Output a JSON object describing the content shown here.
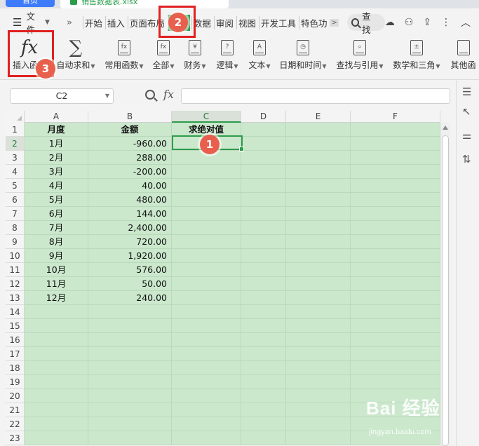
{
  "tabs": {
    "home": "首页",
    "file": "销售数据表.xlsx"
  },
  "menu": {
    "file_label": "文件",
    "more_symbol": "»",
    "items": [
      "开始",
      "插入",
      "页面布局",
      "公式",
      "数据",
      "审阅",
      "视图",
      "开发工具",
      "特色功"
    ],
    "active_index": 3,
    "scroll_symbol": ">",
    "search_label": "查找"
  },
  "ribbon": {
    "buttons": [
      {
        "label": "插入函数",
        "dropdown": false
      },
      {
        "label": "自动求和",
        "dropdown": true
      },
      {
        "label": "常用函数",
        "dropdown": true
      },
      {
        "label": "全部",
        "dropdown": true
      },
      {
        "label": "财务",
        "dropdown": true
      },
      {
        "label": "逻辑",
        "dropdown": true
      },
      {
        "label": "文本",
        "dropdown": true
      },
      {
        "label": "日期和时间",
        "dropdown": true
      },
      {
        "label": "查找与引用",
        "dropdown": true
      },
      {
        "label": "数学和三角",
        "dropdown": true
      },
      {
        "label": "其他函",
        "dropdown": false
      }
    ],
    "icon_fx": "fx",
    "icon_sigma": "∑",
    "icon_finance": "¥",
    "icon_logic": "?",
    "icon_text": "A"
  },
  "formula_bar": {
    "name_box": "C2",
    "fx_label": "fx",
    "value": ""
  },
  "sheet": {
    "columns": [
      "A",
      "B",
      "C",
      "D",
      "E",
      "F"
    ],
    "selected_column": "C",
    "selected_row": 2,
    "row_numbers": [
      "1",
      "2",
      "3",
      "4",
      "5",
      "6",
      "7",
      "8",
      "9",
      "10",
      "11",
      "12",
      "13",
      "14",
      "15",
      "16",
      "17",
      "18",
      "19",
      "20",
      "21",
      "22",
      "23"
    ],
    "header": {
      "a": "月度",
      "b": "金额",
      "c": "求绝对值"
    },
    "rows": [
      {
        "a": "1月",
        "b": "-960.00"
      },
      {
        "a": "2月",
        "b": "288.00"
      },
      {
        "a": "3月",
        "b": "-200.00"
      },
      {
        "a": "4月",
        "b": "40.00"
      },
      {
        "a": "5月",
        "b": "480.00"
      },
      {
        "a": "6月",
        "b": "144.00"
      },
      {
        "a": "7月",
        "b": "2,400.00"
      },
      {
        "a": "8月",
        "b": "720.00"
      },
      {
        "a": "9月",
        "b": "1,920.00"
      },
      {
        "a": "10月",
        "b": "576.00"
      },
      {
        "a": "11月",
        "b": "50.00"
      },
      {
        "a": "12月",
        "b": "240.00"
      }
    ]
  },
  "annotations": {
    "badge1": "1",
    "badge2": "2",
    "badge3": "3"
  },
  "watermark": {
    "line1": "Bai 经验",
    "line2": "jingyan.baidu.com"
  },
  "colors": {
    "accent_green": "#2d9c4a",
    "cell_fill": "#cbe8cd",
    "annotation_red": "#e02020",
    "badge": "#e8604d",
    "home_tab": "#3e7bfa"
  }
}
